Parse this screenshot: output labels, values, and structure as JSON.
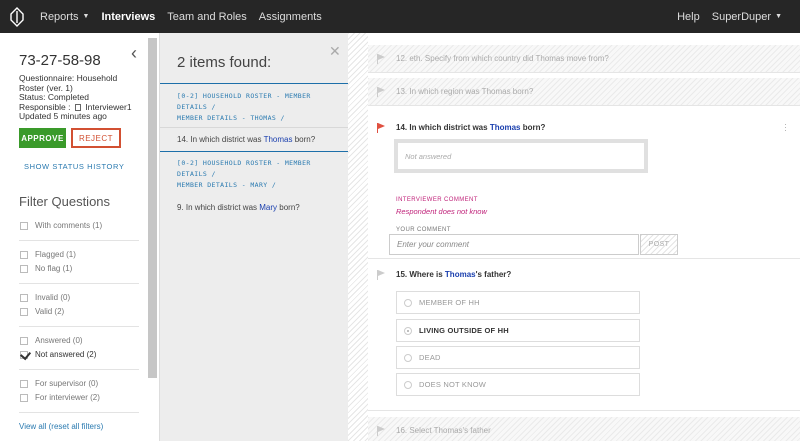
{
  "nav": {
    "items": [
      {
        "label": "Reports",
        "has_caret": true
      },
      {
        "label": "Interviews",
        "active": true
      },
      {
        "label": "Team and Roles"
      },
      {
        "label": "Assignments"
      }
    ],
    "help": "Help",
    "user": "SuperDuper"
  },
  "interview": {
    "id": "73-27-58-98",
    "questionnaire": "Questionnaire: Household Roster (ver. 1)",
    "status": "Status: Completed",
    "responsible_label": "Responsible :",
    "responsible_value": "Interviewer1",
    "updated": "Updated 5 minutes ago",
    "approve": "APPROVE",
    "reject": "REJECT",
    "status_history": "SHOW STATUS HISTORY"
  },
  "filters": {
    "title": "Filter Questions",
    "items": [
      {
        "label": "With comments (1)",
        "checked": false
      },
      {
        "label": "Flagged (1)",
        "checked": false
      },
      {
        "label": "No flag (1)",
        "checked": false
      },
      {
        "label": "Invalid (0)",
        "checked": false
      },
      {
        "label": "Valid (2)",
        "checked": false
      },
      {
        "label": "Answered (0)",
        "checked": false
      },
      {
        "label": "Not answered (2)",
        "checked": true
      },
      {
        "label": "For supervisor (0)",
        "checked": false
      },
      {
        "label": "For interviewer (2)",
        "checked": false
      }
    ],
    "view_all": "View all (reset all filters)"
  },
  "search": {
    "title": "2 items found:",
    "results": [
      {
        "path1": "[0-2] HOUSEHOLD ROSTER - MEMBER",
        "path2": "DETAILS /",
        "path3": "MEMBER DETAILS - THOMAS /",
        "q_prefix": "14. In which district was ",
        "q_name": "Thomas",
        "q_suffix": " born?"
      },
      {
        "path1": "[0-2] HOUSEHOLD ROSTER - MEMBER",
        "path2": "DETAILS /",
        "path3": "MEMBER DETAILS - MARY /",
        "q_prefix": "9. In which district was ",
        "q_name": "Mary",
        "q_suffix": " born?"
      }
    ]
  },
  "questions": {
    "q12": "12. eth. Specify from which country did Thomas move from?",
    "q13": "13. In which region was Thomas born?",
    "q14": {
      "prefix": "14. In which district was ",
      "name": "Thomas",
      "suffix": " born?",
      "answer_placeholder": "Not answered",
      "interviewer_comment_label": "INTERVIEWER COMMENT",
      "interviewer_comment": "Respondent does not know",
      "your_comment_label": "YOUR COMMENT",
      "your_comment_placeholder": "Enter your comment",
      "post": "POST"
    },
    "q15": {
      "prefix": "15. Where is ",
      "name": "Thomas",
      "suffix": "'s father?",
      "options": [
        "MEMBER OF HH",
        "LIVING OUTSIDE OF HH",
        "DEAD",
        "DOES NOT KNOW"
      ],
      "selected": "LIVING OUTSIDE OF HH"
    },
    "q16": "16. Select Thomas's father"
  },
  "colors": {
    "nav_bg": "#262626",
    "approve": "#3a9a2a",
    "reject": "#d25032",
    "link": "#2a7ab0",
    "highlight": "#1a3fae",
    "comment": "#c0237a",
    "flag_active": "#e05040"
  }
}
